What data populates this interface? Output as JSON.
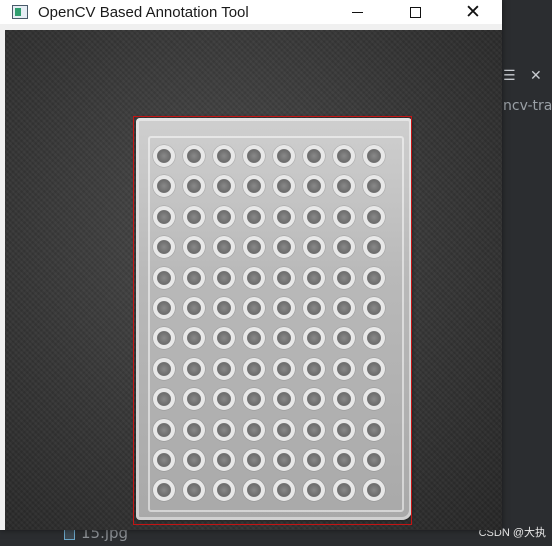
{
  "window": {
    "title": "OpenCV Based Annotation Tool",
    "controls": {
      "minimize": "minimize",
      "maximize": "maximize",
      "close": "close"
    }
  },
  "annotation": {
    "box_color": "#c41414"
  },
  "plate": {
    "rows": 12,
    "cols": 8
  },
  "ide": {
    "tab_fragment": "ncv-tra",
    "file_name": "15.jpg"
  },
  "watermark": "CSDN @大执"
}
